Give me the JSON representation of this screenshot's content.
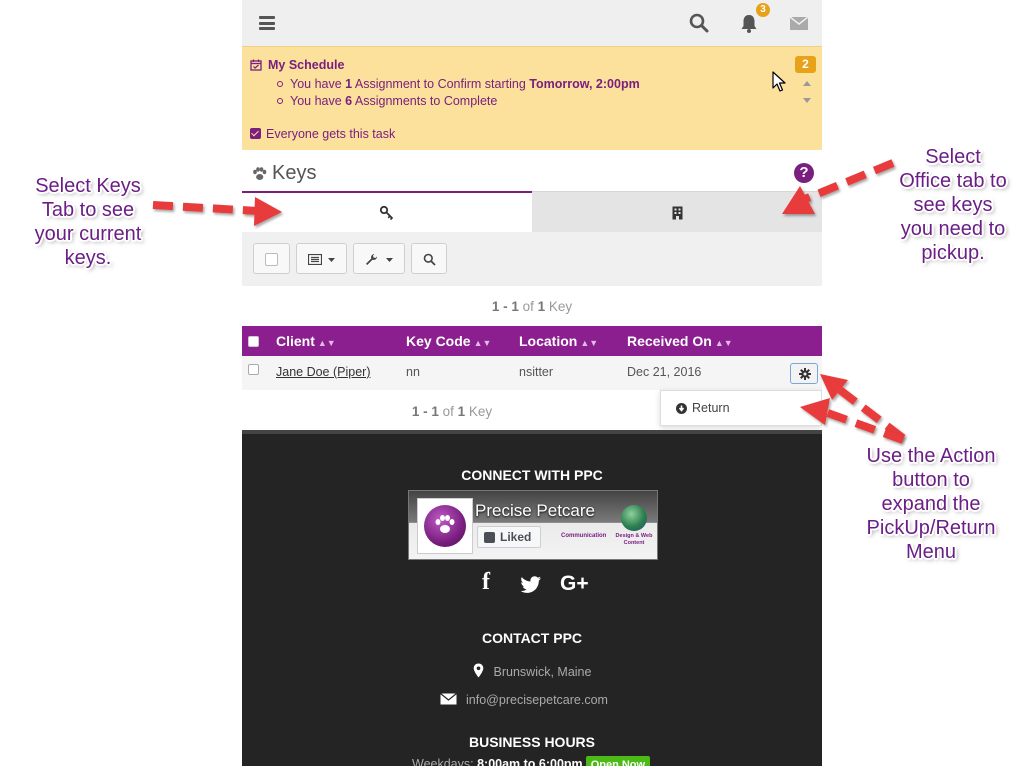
{
  "topbar": {
    "bell_count": "3"
  },
  "schedule": {
    "title": "My Schedule",
    "badge": "2",
    "line1": {
      "pre": "You have ",
      "count": "1",
      "mid": " Assignment to Confirm starting ",
      "when": "Tomorrow, 2:00pm"
    },
    "line2": {
      "pre": "You have ",
      "count": "6",
      "post": " Assignments to Complete"
    },
    "task": "Everyone gets this task"
  },
  "keys": {
    "title": "Keys",
    "help": "?",
    "count": {
      "from": "1",
      "sep": " - ",
      "to": "1",
      "of": " of ",
      "total": "1",
      "unit": " Key"
    }
  },
  "table": {
    "headers": [
      "Client",
      "Key Code",
      "Location",
      "Received On"
    ],
    "rows": [
      {
        "client": "Jane Doe (Piper)",
        "key_code": "nn",
        "location": "nsitter",
        "received_on": "Dec 21, 2016"
      }
    ]
  },
  "dropdown": {
    "return_label": "Return"
  },
  "footer": {
    "connect_heading": "CONNECT WITH PPC",
    "fb_name": "Precise Petcare",
    "fb_liked": "Liked",
    "fb_comm": "Communication",
    "fb_design": "Design & Web Content",
    "social": {
      "facebook": "f",
      "google": "G+"
    },
    "contact_heading": "CONTACT PPC",
    "location": "Brunswick, Maine",
    "email": "info@precisepetcare.com",
    "hours_heading": "BUSINESS HOURS",
    "hours": {
      "label": "Weekdays: ",
      "time": "8:00am to 6:00pm",
      "open": "Open Now"
    }
  },
  "annotations": {
    "keys_tab": [
      "Select Keys",
      "Tab to see",
      "your current",
      "keys."
    ],
    "office_tab": [
      "Select",
      "Office tab to",
      "see keys",
      "you need to",
      "pickup."
    ],
    "action": [
      "Use the Action",
      "button to",
      "expand the",
      "PickUp/Return",
      "Menu"
    ]
  },
  "colors": {
    "accent": "#7a1f80",
    "table_header": "#8b1f8f",
    "schedule_bg": "#fbe19b",
    "badge": "#e8a21a",
    "arrow": "#e83a3a",
    "open_now": "#4cbb17"
  }
}
